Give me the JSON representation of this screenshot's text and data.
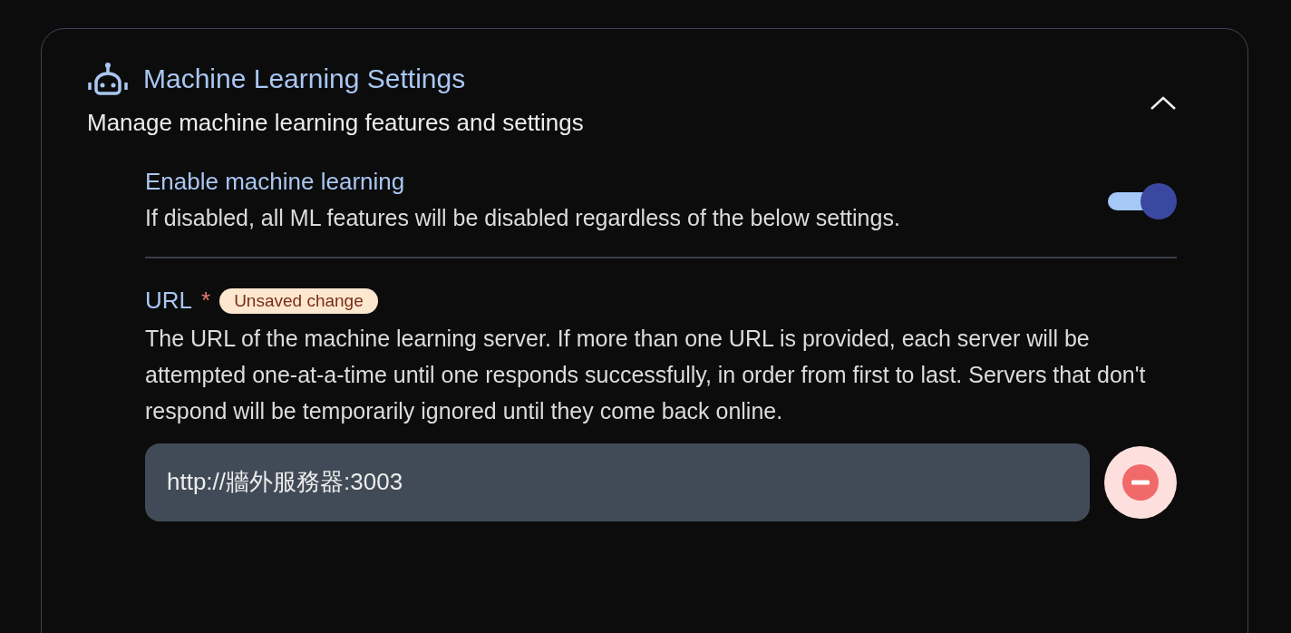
{
  "card": {
    "title": "Machine Learning Settings",
    "subtitle": "Manage machine learning features and settings",
    "expanded": true
  },
  "settings": [
    {
      "kind": "toggle",
      "label": "Enable machine learning",
      "description": "If disabled, all ML features will be disabled regardless of the below settings.",
      "on": true
    },
    {
      "kind": "url",
      "label": "URL",
      "required_mark": "*",
      "badge": "Unsaved change",
      "description": "The URL of the machine learning server. If more than one URL is provided, each server will be attempted one-at-a-time until one responds successfully, in order from first to last. Servers that don't respond will be temporarily ignored until they come back online.",
      "values": [
        "http://牆外服務器:3003"
      ]
    }
  ]
}
